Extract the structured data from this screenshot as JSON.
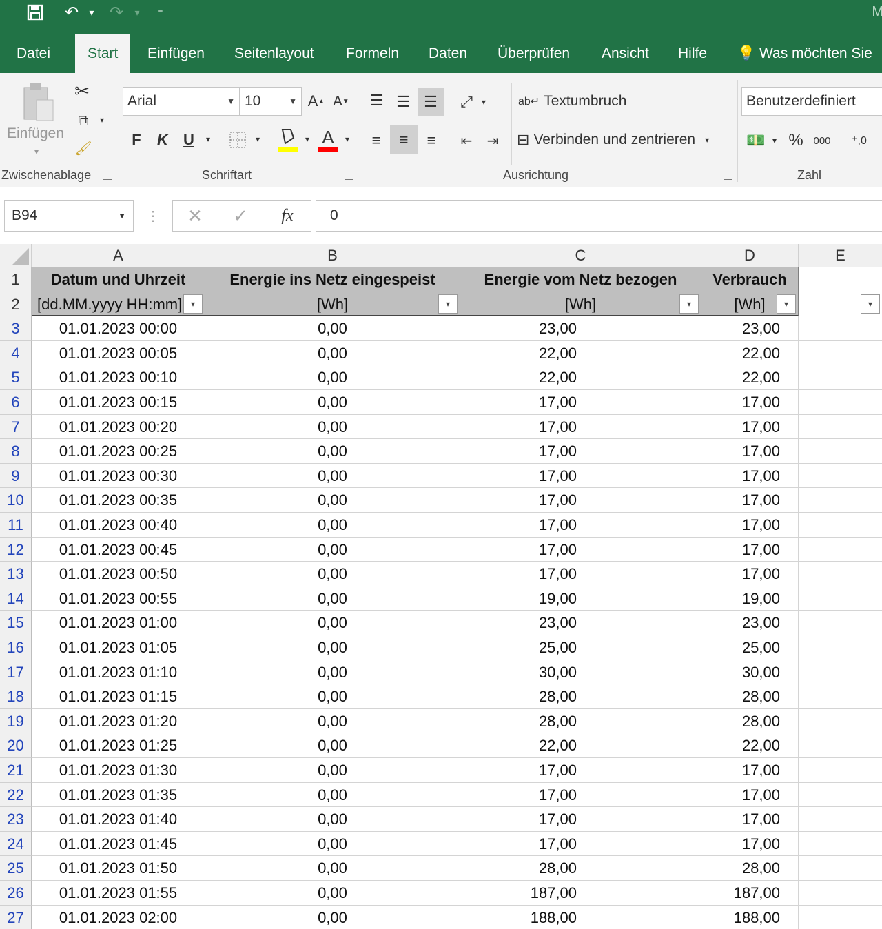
{
  "title_bar": {
    "app_title": "M"
  },
  "ribbon_tabs": [
    "Datei",
    "Start",
    "Einfügen",
    "Seitenlayout",
    "Formeln",
    "Daten",
    "Überprüfen",
    "Ansicht",
    "Hilfe"
  ],
  "tell_me": "Was möchten Sie",
  "ribbon": {
    "paste_label": "Einfügen",
    "clipboard_group": "Zwischenablage",
    "font_name": "Arial",
    "font_size": "10",
    "bold": "F",
    "italic": "K",
    "underline": "U",
    "font_group": "Schriftart",
    "wrap_text": "Textumbruch",
    "merge_center": "Verbinden und zentrieren",
    "alignment_group": "Ausrichtung",
    "number_format": "Benutzerdefiniert",
    "percent": "%",
    "thousands": "000",
    "number_group": "Zahl",
    "colors": {
      "fill": "#ffff00",
      "font": "#ff0000"
    }
  },
  "formula_bar": {
    "name_box": "B94",
    "fx": "fx",
    "formula": "0"
  },
  "sheet": {
    "columns": [
      "A",
      "B",
      "C",
      "D",
      "E"
    ],
    "header_row": {
      "num": "1",
      "cells": [
        "Datum und Uhrzeit",
        "Energie ins Netz eingespeist",
        "Energie vom Netz bezogen",
        "Verbrauch"
      ]
    },
    "units_row": {
      "num": "2",
      "cells": [
        "[dd.MM.yyyy HH:mm]",
        "[Wh]",
        "[Wh]",
        "[Wh]"
      ]
    },
    "rows": [
      {
        "num": "3",
        "a": "01.01.2023 00:00",
        "b": "0,00",
        "c": "23,00",
        "d": "23,00"
      },
      {
        "num": "4",
        "a": "01.01.2023 00:05",
        "b": "0,00",
        "c": "22,00",
        "d": "22,00"
      },
      {
        "num": "5",
        "a": "01.01.2023 00:10",
        "b": "0,00",
        "c": "22,00",
        "d": "22,00"
      },
      {
        "num": "6",
        "a": "01.01.2023 00:15",
        "b": "0,00",
        "c": "17,00",
        "d": "17,00"
      },
      {
        "num": "7",
        "a": "01.01.2023 00:20",
        "b": "0,00",
        "c": "17,00",
        "d": "17,00"
      },
      {
        "num": "8",
        "a": "01.01.2023 00:25",
        "b": "0,00",
        "c": "17,00",
        "d": "17,00"
      },
      {
        "num": "9",
        "a": "01.01.2023 00:30",
        "b": "0,00",
        "c": "17,00",
        "d": "17,00"
      },
      {
        "num": "10",
        "a": "01.01.2023 00:35",
        "b": "0,00",
        "c": "17,00",
        "d": "17,00"
      },
      {
        "num": "11",
        "a": "01.01.2023 00:40",
        "b": "0,00",
        "c": "17,00",
        "d": "17,00"
      },
      {
        "num": "12",
        "a": "01.01.2023 00:45",
        "b": "0,00",
        "c": "17,00",
        "d": "17,00"
      },
      {
        "num": "13",
        "a": "01.01.2023 00:50",
        "b": "0,00",
        "c": "17,00",
        "d": "17,00"
      },
      {
        "num": "14",
        "a": "01.01.2023 00:55",
        "b": "0,00",
        "c": "19,00",
        "d": "19,00"
      },
      {
        "num": "15",
        "a": "01.01.2023 01:00",
        "b": "0,00",
        "c": "23,00",
        "d": "23,00"
      },
      {
        "num": "16",
        "a": "01.01.2023 01:05",
        "b": "0,00",
        "c": "25,00",
        "d": "25,00"
      },
      {
        "num": "17",
        "a": "01.01.2023 01:10",
        "b": "0,00",
        "c": "30,00",
        "d": "30,00"
      },
      {
        "num": "18",
        "a": "01.01.2023 01:15",
        "b": "0,00",
        "c": "28,00",
        "d": "28,00"
      },
      {
        "num": "19",
        "a": "01.01.2023 01:20",
        "b": "0,00",
        "c": "28,00",
        "d": "28,00"
      },
      {
        "num": "20",
        "a": "01.01.2023 01:25",
        "b": "0,00",
        "c": "22,00",
        "d": "22,00"
      },
      {
        "num": "21",
        "a": "01.01.2023 01:30",
        "b": "0,00",
        "c": "17,00",
        "d": "17,00"
      },
      {
        "num": "22",
        "a": "01.01.2023 01:35",
        "b": "0,00",
        "c": "17,00",
        "d": "17,00"
      },
      {
        "num": "23",
        "a": "01.01.2023 01:40",
        "b": "0,00",
        "c": "17,00",
        "d": "17,00"
      },
      {
        "num": "24",
        "a": "01.01.2023 01:45",
        "b": "0,00",
        "c": "17,00",
        "d": "17,00"
      },
      {
        "num": "25",
        "a": "01.01.2023 01:50",
        "b": "0,00",
        "c": "28,00",
        "d": "28,00"
      },
      {
        "num": "26",
        "a": "01.01.2023 01:55",
        "b": "0,00",
        "c": "187,00",
        "d": "187,00"
      },
      {
        "num": "27",
        "a": "01.01.2023 02:00",
        "b": "0,00",
        "c": "188,00",
        "d": "188,00"
      }
    ]
  }
}
